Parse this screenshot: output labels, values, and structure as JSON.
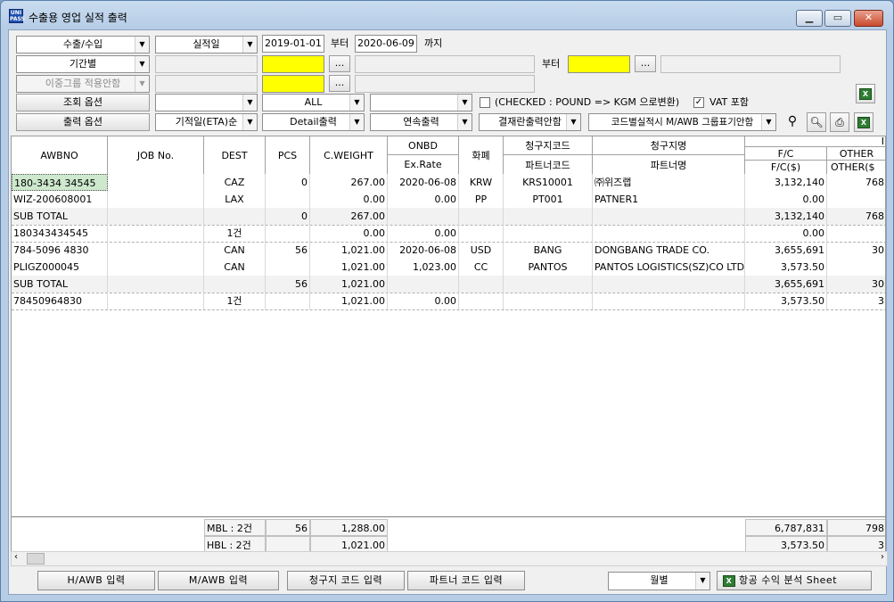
{
  "window": {
    "title": "수출용 영업 실적 출력",
    "icon_text": "유니\nPASS",
    "controls": {
      "minimize": "▭",
      "maximize": "▭",
      "close": "✕"
    }
  },
  "filters": {
    "row1": {
      "type": "수출/수입",
      "date_kind": "실적일",
      "from_date": "2019-01-01",
      "from_label": "부터",
      "to_date": "2020-06-09",
      "to_label": "까지"
    },
    "row2": {
      "period": "기간별",
      "from_label": "부터",
      "dots": "..."
    },
    "row3": {
      "group": "이중그룹 적용안함",
      "dots": "..."
    },
    "row4": {
      "label": "조회 옵션",
      "all": "ALL",
      "checked_text": "(CHECKED : POUND => KGM 으로변환)",
      "vat_text": "VAT 포함",
      "vat_mark": "✓"
    },
    "row5": {
      "label": "출력 옵션",
      "sort": "기적일(ETA)순",
      "detail": "Detail출력",
      "continuous": "연속출력",
      "settlement": "결재란출력안함",
      "code": "코드별실적시 M/AWB 그룹표기안함"
    }
  },
  "icons": {
    "binoculars": "🔭",
    "preview": "🔍",
    "print": "🖶",
    "excel": "X"
  },
  "grid": {
    "headers": {
      "awbno": "AWBNO",
      "job_no": "JOB No.",
      "dest": "DEST",
      "pcs": "PCS",
      "cweight": "C.WEIGHT",
      "onbd": "ONBD",
      "exrate": "Ex.Rate",
      "currency": "화폐",
      "bill_code": "청구지코드",
      "partner_code": "파트너코드",
      "bill_name": "청구지명",
      "partner_name": "파트너명",
      "fc": "F/C",
      "fc_usd": "F/C($)",
      "other": "OTHER",
      "other_usd": "OTHER($",
      "top_right": "I"
    },
    "rows": [
      {
        "awbno": "180-3434 34545",
        "job": "",
        "dest": "CAZ",
        "pcs": "0",
        "cw": "267.00",
        "onbd": "2020-06-08",
        "cur": "KRW",
        "code": "KRS10001",
        "name": "㈜위즈랩",
        "fc": "3,132,140",
        "other": "768"
      },
      {
        "awbno": "WIZ-200608001",
        "job": "",
        "dest": "LAX",
        "pcs": "",
        "cw": "0.00",
        "onbd": "0.00",
        "cur": "PP",
        "code": "PT001",
        "name": "PATNER1",
        "fc": "0.00",
        "other": ""
      },
      {
        "awbno": "SUB TOTAL",
        "job": "",
        "dest": "",
        "pcs": "0",
        "cw": "267.00",
        "onbd": "",
        "cur": "",
        "code": "",
        "name": "",
        "fc": "3,132,140",
        "other": "768"
      },
      {
        "awbno": "180343434545",
        "job": "",
        "dest": "1건",
        "pcs": "",
        "cw": "0.00",
        "onbd": "0.00",
        "cur": "",
        "code": "",
        "name": "",
        "fc": "0.00",
        "other": ""
      },
      {
        "awbno": "784-5096 4830",
        "job": "",
        "dest": "CAN",
        "pcs": "56",
        "cw": "1,021.00",
        "onbd": "2020-06-08",
        "cur": "USD",
        "code": "BANG",
        "name": "DONGBANG TRADE CO.",
        "fc": "3,655,691",
        "other": "30"
      },
      {
        "awbno": "PLIGZ000045",
        "job": "",
        "dest": "CAN",
        "pcs": "",
        "cw": "1,021.00",
        "onbd": "1,023.00",
        "cur": "CC",
        "code": "PANTOS",
        "name": "PANTOS LOGISTICS(SZ)CO LTD GU",
        "fc": "3,573.50",
        "other": ""
      },
      {
        "awbno": "SUB TOTAL",
        "job": "",
        "dest": "",
        "pcs": "56",
        "cw": "1,021.00",
        "onbd": "",
        "cur": "",
        "code": "",
        "name": "",
        "fc": "3,655,691",
        "other": "30"
      },
      {
        "awbno": "78450964830",
        "job": "",
        "dest": "1건",
        "pcs": "",
        "cw": "1,021.00",
        "onbd": "0.00",
        "cur": "",
        "code": "",
        "name": "",
        "fc": "3,573.50",
        "other": "3"
      }
    ],
    "footer": {
      "mbl_label": "MBL : 2건",
      "mbl_pcs": "56",
      "mbl_cw": "1,288.00",
      "mbl_fc": "6,787,831",
      "mbl_other": "798",
      "hbl_label": "HBL : 2건",
      "hbl_cw": "1,021.00",
      "hbl_fc": "3,573.50",
      "hbl_other": "3"
    }
  },
  "bottom": {
    "hawb": "H/AWB 입력",
    "mawb": "M/AWB 입력",
    "billcode": "청구지 코드 입력",
    "partnercode": "파트너 코드 입력",
    "monthly": "월별",
    "analysis": "항공 수익 분석  Sheet"
  }
}
